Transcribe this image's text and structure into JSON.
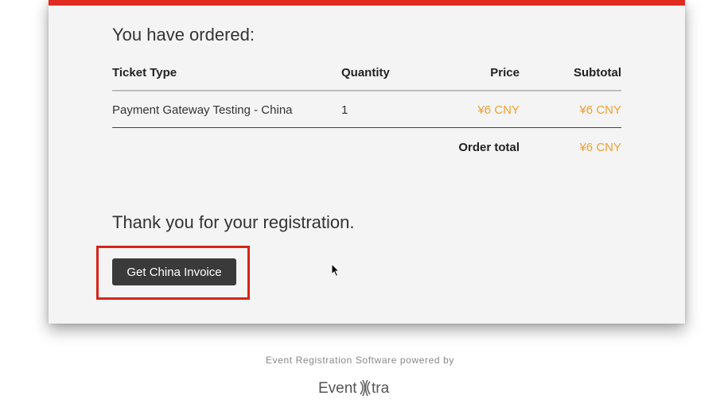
{
  "order": {
    "heading": "You have ordered:",
    "columns": {
      "ticket_type": "Ticket Type",
      "quantity": "Quantity",
      "price": "Price",
      "subtotal": "Subtotal"
    },
    "rows": [
      {
        "ticket_type": "Payment Gateway Testing - China",
        "quantity": "1",
        "price": "¥6 CNY",
        "subtotal": "¥6 CNY"
      }
    ],
    "total_label": "Order total",
    "total_value": "¥6 CNY"
  },
  "thankyou": "Thank you for your registration.",
  "invoice_button": "Get China Invoice",
  "footer": {
    "powered_by": "Event Registration Software powered by",
    "logo": "EventXtra"
  },
  "colors": {
    "accent": "#e02b20",
    "price": "#f0a030",
    "button": "#3a3a3a",
    "highlight": "#d72419"
  }
}
